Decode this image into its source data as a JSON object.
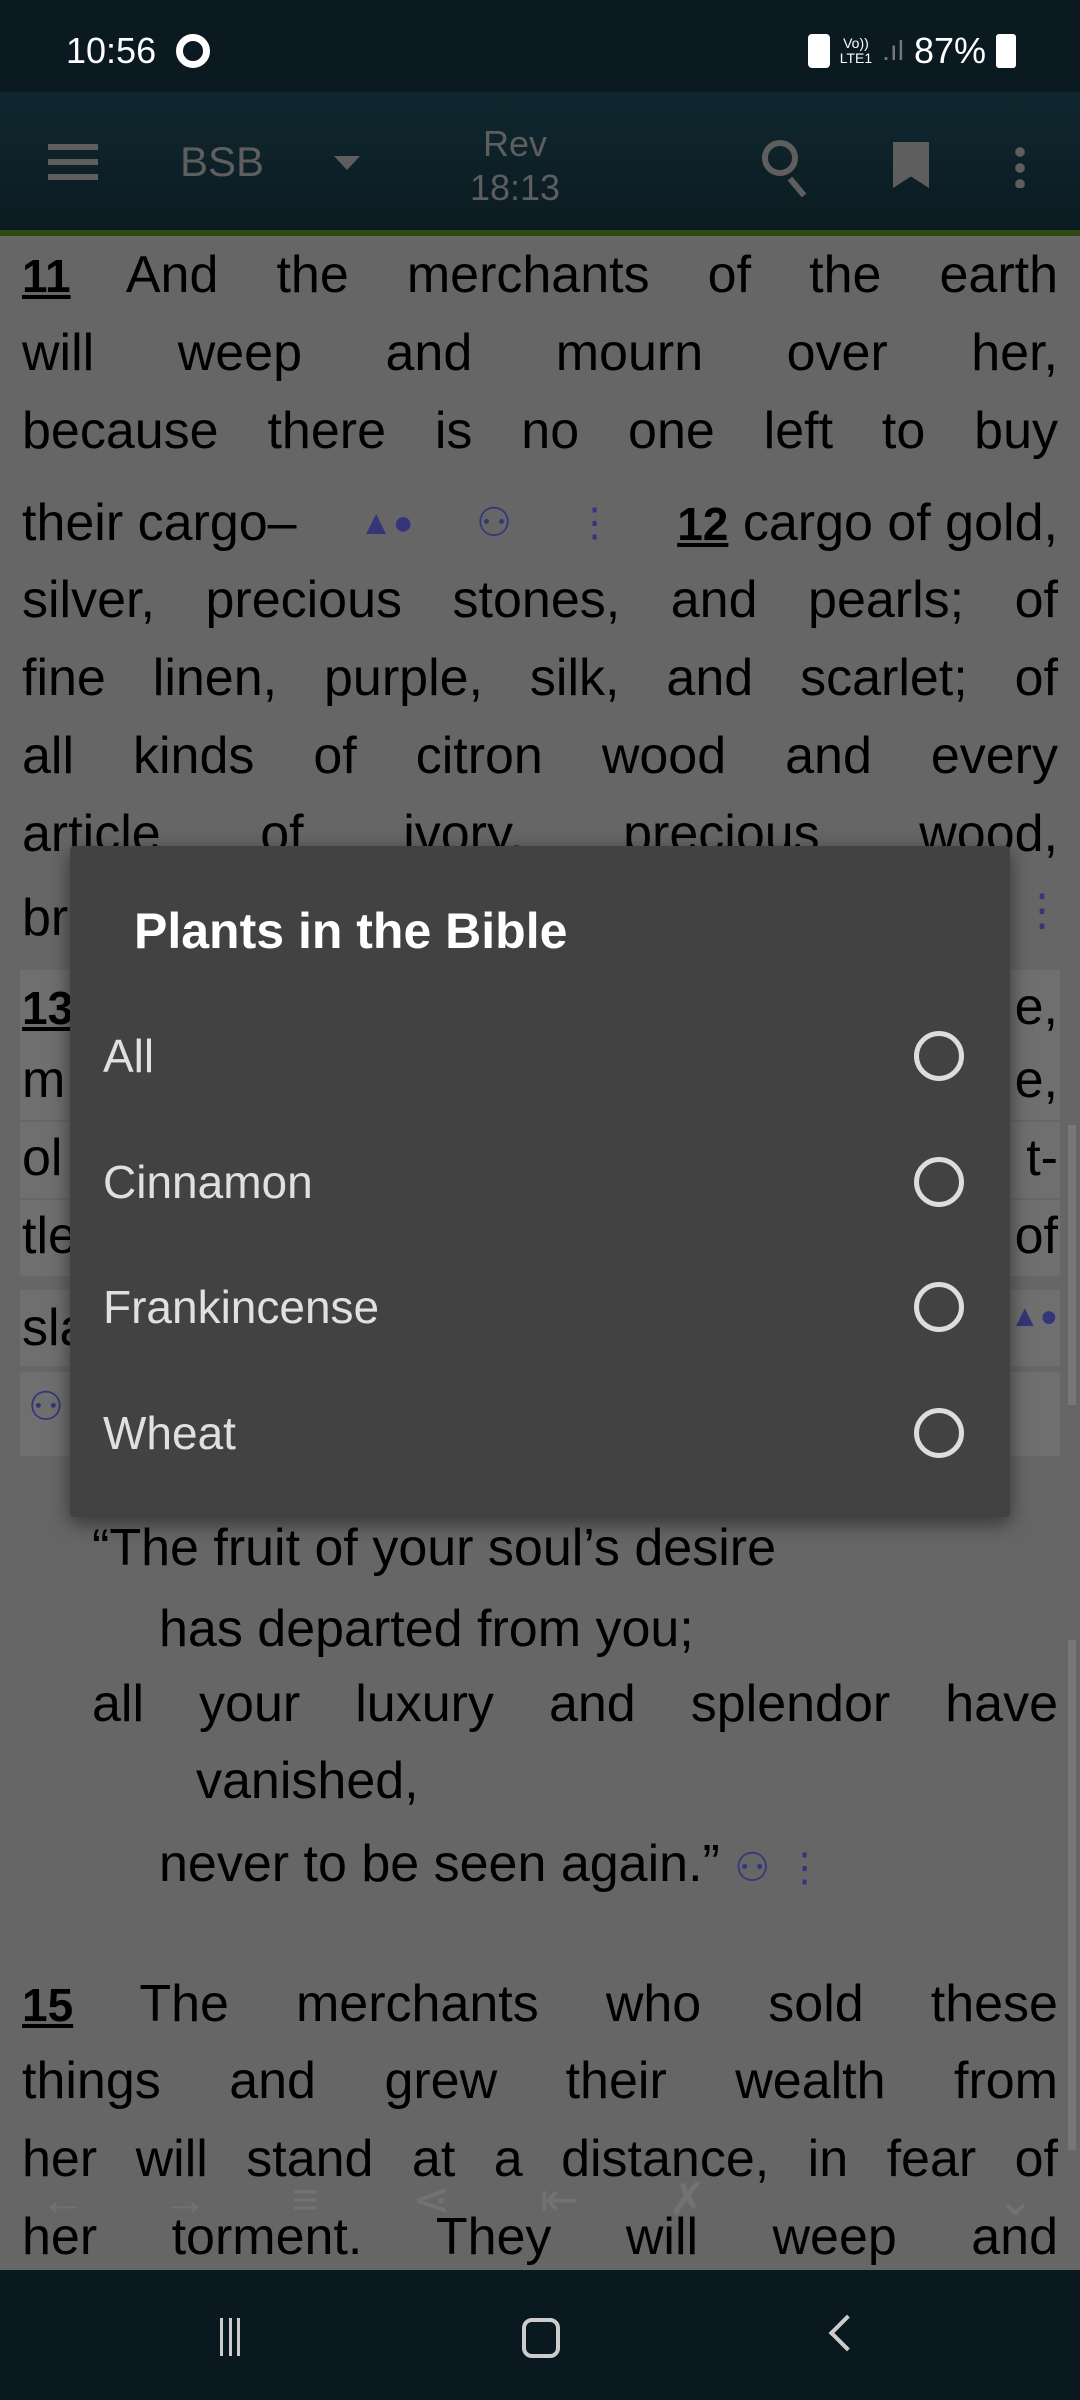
{
  "status_bar": {
    "time": "10:56",
    "network_top": "Vo))",
    "network_bottom": "LTE1",
    "battery": "87%"
  },
  "app_bar": {
    "translation": "BSB",
    "book": "Rev",
    "reference": "18:13",
    "icons": [
      "menu-icon",
      "dropdown-icon",
      "search-icon",
      "bookmark-icon",
      "more-vert-icon"
    ]
  },
  "text": {
    "l1_num": "11",
    "l1": "And the merchants of the earth",
    "l2": "will weep and mourn over her,",
    "l3": "because there is no one left to buy",
    "l4a": "their cargo–",
    "l4_num": "12",
    "l4b": "cargo of gold,",
    "l5": "silver, precious stones, and pearls; of",
    "l6": "fine linen, purple, silk, and scarlet; of",
    "l7": "all kinds of citron wood and every",
    "l8": "article of ivory, precious wood,",
    "l9": "br",
    "l10": "13",
    "l10r": "e,",
    "l11": "m",
    "l11r": "e,",
    "l12": "ol",
    "l12r": "t-",
    "l13": "tle",
    "l13r": "of",
    "l14": "sla",
    "p1": "“The fruit of your soul’s desire",
    "p2": "has departed from you;",
    "p3": "all your luxury and splendor have",
    "p4": "vanished,",
    "p5": "never to be seen again.”",
    "l15_num": "15",
    "l15": "The merchants who sold these",
    "l16": "things and grew their wealth from",
    "l17": "her will stand at a distance, in fear of",
    "l18": "her torment. They will weep and"
  },
  "dialog": {
    "title": "Plants in the Bible",
    "options": [
      {
        "label": "All",
        "selected": false
      },
      {
        "label": "Cinnamon",
        "selected": false
      },
      {
        "label": "Frankincense",
        "selected": false
      },
      {
        "label": "Wheat",
        "selected": false
      }
    ]
  },
  "colors": {
    "annotation_icon": "#35357a",
    "app_bar": "#10272f",
    "accent_line": "#2d4a10",
    "dialog": "#424242"
  }
}
